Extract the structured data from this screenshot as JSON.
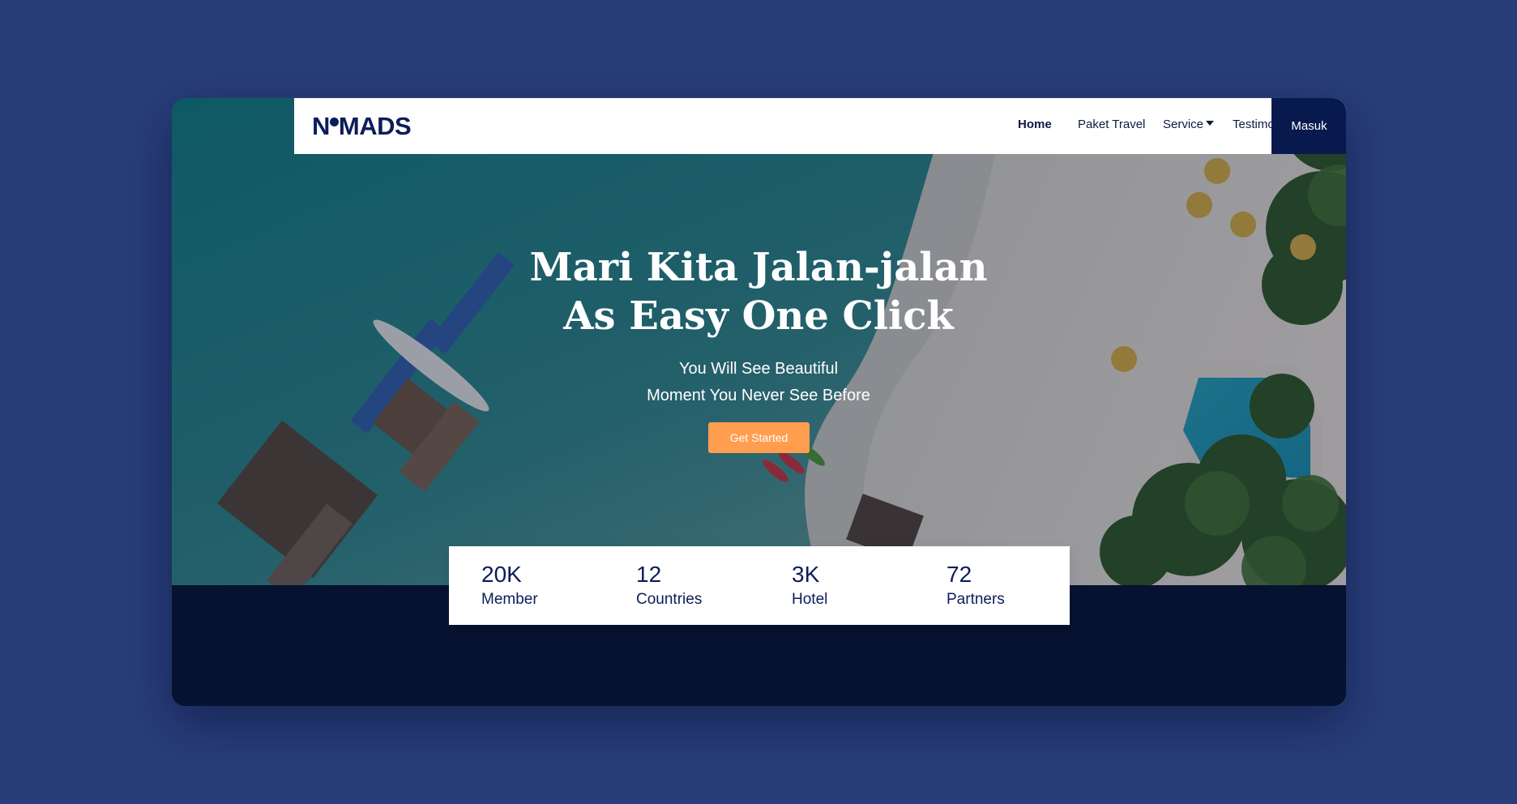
{
  "brand": {
    "logo_text_start": "N",
    "logo_text_end": "MADS"
  },
  "nav": {
    "items": [
      {
        "label": "Home",
        "active": true
      },
      {
        "label": "Paket Travel",
        "active": false
      },
      {
        "label": "Service",
        "active": false,
        "has_dropdown": true
      },
      {
        "label": "Testimonial",
        "active": false
      }
    ],
    "login_label": "Masuk"
  },
  "hero": {
    "title_line_1": "Mari Kita Jalan-jalan",
    "title_line_2": "As Easy One Click",
    "subtitle_line_1": "You Will See Beautiful",
    "subtitle_line_2": "Moment You Never See Before",
    "cta_label": "Get Started"
  },
  "stats": [
    {
      "value": "20K",
      "label": "Member"
    },
    {
      "value": "12",
      "label": "Countries"
    },
    {
      "value": "3K",
      "label": "Hotel"
    },
    {
      "value": "72",
      "label": "Partners"
    }
  ],
  "colors": {
    "page_background": "#283d7a",
    "brand_navy": "#081a4d",
    "footer_navy": "#06122f",
    "cta_orange": "#ff9e4f",
    "text_dark": "#0d1b40"
  },
  "icons": {
    "logo_mark": "map-pin-dot-icon",
    "service_dropdown": "caret-down-icon"
  }
}
